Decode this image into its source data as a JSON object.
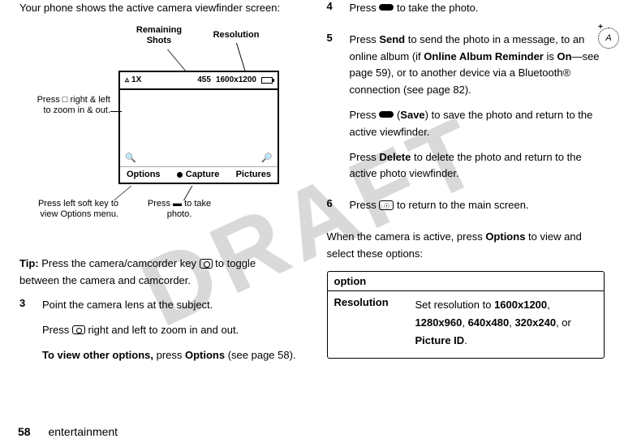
{
  "watermark": "DRAFT",
  "left": {
    "intro": "Your phone shows the active camera viewfinder screen:",
    "labels": {
      "remaining": "Remaining Shots",
      "resolution": "Resolution",
      "zoom_tip": "Press □ right & left to zoom in & out.",
      "left_softkey": "Press left soft key to view Options menu.",
      "center_press": "Press ▬ to take photo."
    },
    "viewfinder": {
      "zoom": "1X",
      "shots": "455",
      "res": "1600x1200",
      "soft_left": "Options",
      "soft_center": "Capture",
      "soft_right": "Pictures"
    },
    "tip_prefix": "Tip:",
    "tip_text": " Press the camera/camcorder key ",
    "tip_text2": " to toggle between the camera and camcorder.",
    "step3_num": "3",
    "step3": "Point the camera lens at the subject.",
    "step3b_a": "Press ",
    "step3b_b": " right and left to zoom in and out.",
    "viewother_bold": "To view other options,",
    "viewother_rest": " press ",
    "viewother_opt": "Options",
    "viewother_end": " (see page 58)."
  },
  "right": {
    "step4_num": "4",
    "step4_a": "Press ",
    "step4_b": " to take the photo.",
    "step5_num": "5",
    "step5_a": "Press ",
    "step5_send": "Send",
    "step5_b": " to send the photo in a message, to an online album (if ",
    "step5_oar": "Online Album Reminder",
    "step5_c": " is ",
    "step5_on": "On",
    "step5_d": "—see page 59), or to another device via a Bluetooth® connection (see page 82).",
    "step5p2_a": "Press ",
    "step5p2_save": "Save",
    "step5p2_b": ") to save the photo and return to the active viewfinder.",
    "step5p3_a": "Press ",
    "step5p3_del": "Delete",
    "step5p3_b": " to delete the photo and return to the active photo viewfinder.",
    "step6_num": "6",
    "step6_a": "Press ",
    "step6_b": " to return to the main screen.",
    "postcam_a": "When the camera is active, press ",
    "postcam_opt": "Options",
    "postcam_b": " to view and select these options:",
    "table": {
      "header": "option",
      "row1_key": "Resolution",
      "row1_a": "Set resolution to ",
      "row1_r1": "1600x1200",
      "row1_r2": "1280x960",
      "row1_r3": "640x480",
      "row1_r4": "320x240",
      "row1_or": ", or ",
      "row1_pid": "Picture ID",
      "row1_end": "."
    }
  },
  "footer": {
    "page": "58",
    "section": "entertainment"
  }
}
